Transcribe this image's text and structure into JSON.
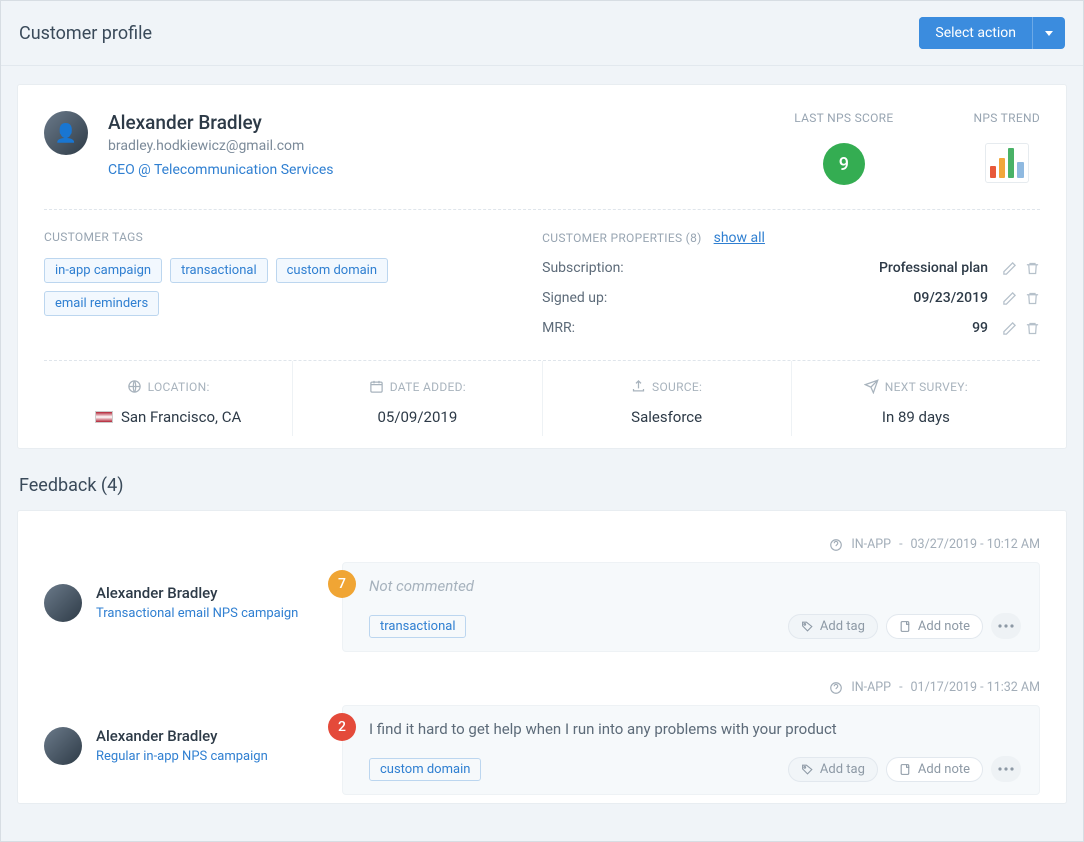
{
  "header": {
    "title": "Customer profile",
    "select_action": "Select action"
  },
  "profile": {
    "name": "Alexander Bradley",
    "email": "bradley.hodkiewicz@gmail.com",
    "role": "CEO @ Telecommunication Services",
    "nps_label": "LAST NPS SCORE",
    "nps_score": "9",
    "trend_label": "NPS TREND"
  },
  "tags_label": "CUSTOMER TAGS",
  "tags": [
    "in-app campaign",
    "transactional",
    "custom domain",
    "email reminders"
  ],
  "props_label": "CUSTOMER PROPERTIES (8)",
  "show_all": "show all",
  "properties": [
    {
      "name": "Subscription:",
      "value": "Professional plan"
    },
    {
      "name": "Signed up:",
      "value": "09/23/2019"
    },
    {
      "name": "MRR:",
      "value": "99"
    }
  ],
  "info": {
    "location_label": "LOCATION:",
    "location_value": "San Francisco, CA",
    "date_label": "DATE ADDED:",
    "date_value": "05/09/2019",
    "source_label": "SOURCE:",
    "source_value": "Salesforce",
    "next_label": "NEXT SURVEY:",
    "next_value": "In 89 days"
  },
  "feedback_title": "Feedback (4)",
  "feedback": [
    {
      "channel": "IN-APP",
      "timestamp": "03/27/2019 - 10:12 AM",
      "name": "Alexander Bradley",
      "campaign": "Transactional email NPS campaign",
      "score": "7",
      "comment": "Not commented",
      "muted": true,
      "tag": "transactional"
    },
    {
      "channel": "IN-APP",
      "timestamp": "01/17/2019 - 11:32 AM",
      "name": "Alexander Bradley",
      "campaign": "Regular in-app NPS campaign",
      "score": "2",
      "comment": "I find it hard to get help when I run into any problems with your product",
      "muted": false,
      "tag": "custom domain"
    }
  ],
  "actions": {
    "add_tag": "Add tag",
    "add_note": "Add note"
  }
}
